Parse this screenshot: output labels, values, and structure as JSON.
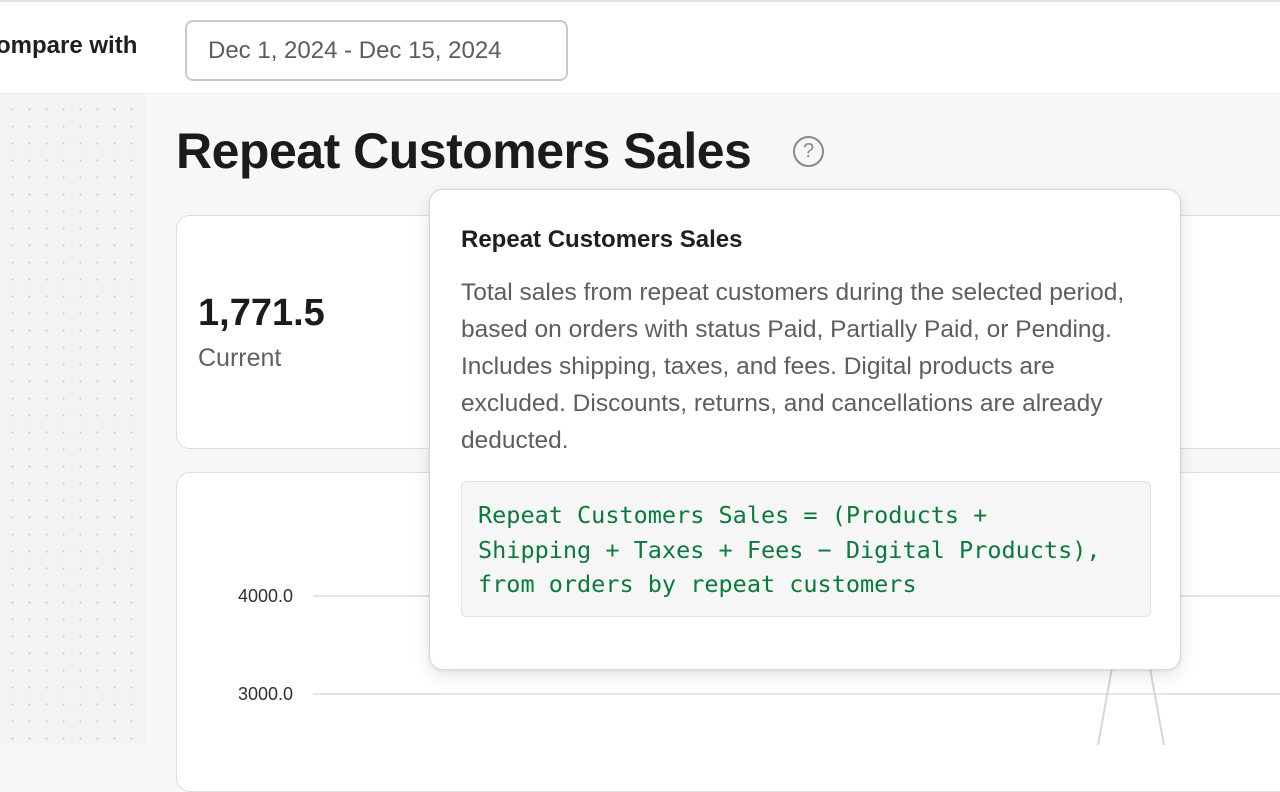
{
  "header": {
    "compare_label": "ompare with",
    "date_range": "Dec 1, 2024 - Dec 15, 2024"
  },
  "page": {
    "title": "Repeat Customers Sales",
    "help_icon": "question-circle-icon"
  },
  "kpi": {
    "value": "1,771.5",
    "label": "Current"
  },
  "chart_data": {
    "type": "line",
    "y_ticks": [
      "4000.0",
      "3000.0"
    ],
    "grid": true
  },
  "tooltip": {
    "title": "Repeat Customers Sales",
    "description": "Total sales from repeat customers during the selected period, based on orders with status Paid, Partially Paid, or Pending. Includes shipping, taxes, and fees. Digital products are excluded. Discounts, returns, and cancellations are already deducted.",
    "formula": "Repeat Customers Sales = (Products +\nShipping + Taxes + Fees − Digital Products),\nfrom orders by repeat customers"
  },
  "colors": {
    "formula_text": "#0a7b3a",
    "gridline": "#dcdcdc"
  }
}
